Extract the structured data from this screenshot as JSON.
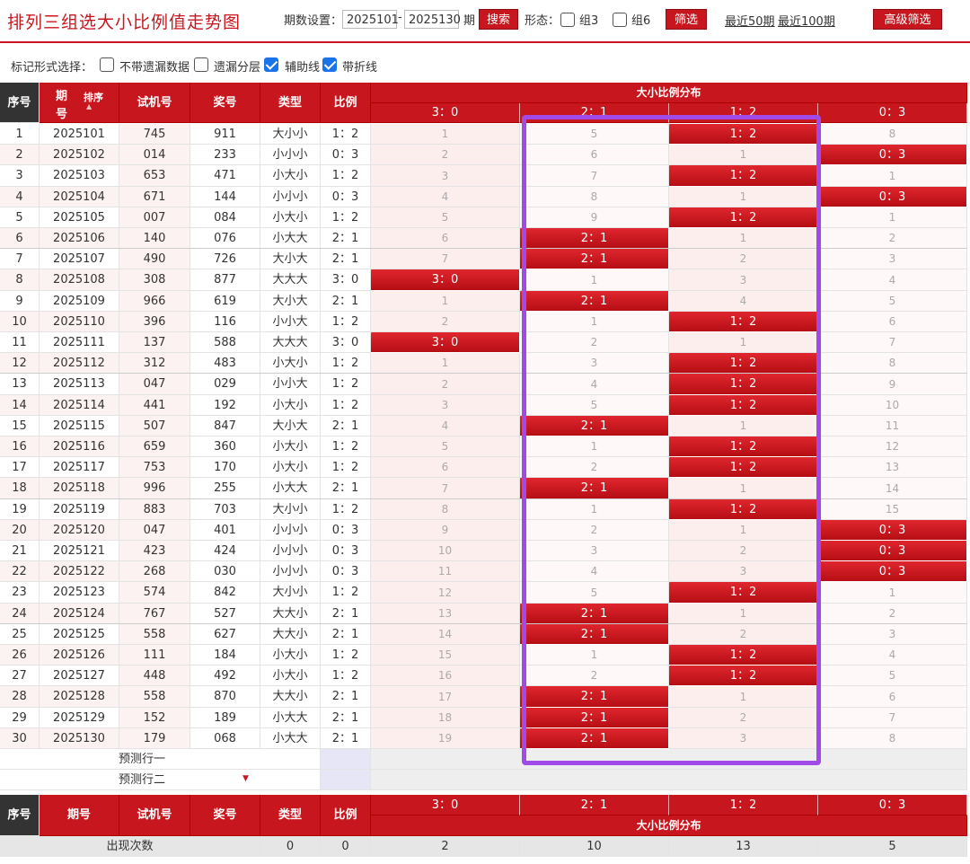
{
  "header": {
    "title": "排列三组选大小比例值走势图",
    "period_label": "期数设置：",
    "start_period": "2025101",
    "dash": "-",
    "end_period": "2025130",
    "period_unit": "期",
    "search_label": "搜索",
    "shape_label": "形态：",
    "group3_label": "组3",
    "group6_label": "组6",
    "filter_label": "筛选",
    "recent50_label": "最近50期",
    "recent100_label": "最近100期",
    "advanced_label": "高级筛选"
  },
  "options": {
    "label": "标记形式选择：",
    "items": [
      {
        "label": "不带遗漏数据",
        "checked": false
      },
      {
        "label": "遗漏分层",
        "checked": false
      },
      {
        "label": "辅助线",
        "checked": true
      },
      {
        "label": "带折线",
        "checked": true
      }
    ]
  },
  "table": {
    "headers": {
      "seq": "序号",
      "period_top": "期",
      "period_bottom": "号",
      "sort": "排序",
      "test_no": "试机号",
      "prize": "奖号",
      "type": "类型",
      "ratio": "比例",
      "dist": "大小比例分布",
      "bottom_period": "期号"
    },
    "ratio_cols": [
      "3：0",
      "2：1",
      "1：2",
      "0：3"
    ],
    "rows": [
      {
        "seq": "1",
        "period": "2025101",
        "test": "745",
        "prize": "911",
        "type": "大小小",
        "ratio": "1：2",
        "cols": [
          "1",
          "5",
          "1：2",
          "8"
        ]
      },
      {
        "seq": "2",
        "period": "2025102",
        "test": "014",
        "prize": "233",
        "type": "小小小",
        "ratio": "0：3",
        "cols": [
          "2",
          "6",
          "1",
          "0：3"
        ]
      },
      {
        "seq": "3",
        "period": "2025103",
        "test": "653",
        "prize": "471",
        "type": "小大小",
        "ratio": "1：2",
        "cols": [
          "3",
          "7",
          "1：2",
          "1"
        ]
      },
      {
        "seq": "4",
        "period": "2025104",
        "test": "671",
        "prize": "144",
        "type": "小小小",
        "ratio": "0：3",
        "cols": [
          "4",
          "8",
          "1",
          "0：3"
        ]
      },
      {
        "seq": "5",
        "period": "2025105",
        "test": "007",
        "prize": "084",
        "type": "小大小",
        "ratio": "1：2",
        "cols": [
          "5",
          "9",
          "1：2",
          "1"
        ]
      },
      {
        "seq": "6",
        "period": "2025106",
        "test": "140",
        "prize": "076",
        "type": "小大大",
        "ratio": "2：1",
        "cols": [
          "6",
          "2：1",
          "1",
          "2"
        ]
      },
      {
        "seq": "7",
        "period": "2025107",
        "test": "490",
        "prize": "726",
        "type": "大小大",
        "ratio": "2：1",
        "cols": [
          "7",
          "2：1",
          "2",
          "3"
        ]
      },
      {
        "seq": "8",
        "period": "2025108",
        "test": "308",
        "prize": "877",
        "type": "大大大",
        "ratio": "3：0",
        "cols": [
          "3：0",
          "1",
          "3",
          "4"
        ]
      },
      {
        "seq": "9",
        "period": "2025109",
        "test": "966",
        "prize": "619",
        "type": "大小大",
        "ratio": "2：1",
        "cols": [
          "1",
          "2：1",
          "4",
          "5"
        ]
      },
      {
        "seq": "10",
        "period": "2025110",
        "test": "396",
        "prize": "116",
        "type": "小小大",
        "ratio": "1：2",
        "cols": [
          "2",
          "1",
          "1：2",
          "6"
        ]
      },
      {
        "seq": "11",
        "period": "2025111",
        "test": "137",
        "prize": "588",
        "type": "大大大",
        "ratio": "3：0",
        "cols": [
          "3：0",
          "2",
          "1",
          "7"
        ]
      },
      {
        "seq": "12",
        "period": "2025112",
        "test": "312",
        "prize": "483",
        "type": "小大小",
        "ratio": "1：2",
        "cols": [
          "1",
          "3",
          "1：2",
          "8"
        ]
      },
      {
        "seq": "13",
        "period": "2025113",
        "test": "047",
        "prize": "029",
        "type": "小小大",
        "ratio": "1：2",
        "cols": [
          "2",
          "4",
          "1：2",
          "9"
        ]
      },
      {
        "seq": "14",
        "period": "2025114",
        "test": "441",
        "prize": "192",
        "type": "小大小",
        "ratio": "1：2",
        "cols": [
          "3",
          "5",
          "1：2",
          "10"
        ]
      },
      {
        "seq": "15",
        "period": "2025115",
        "test": "507",
        "prize": "847",
        "type": "大小大",
        "ratio": "2：1",
        "cols": [
          "4",
          "2：1",
          "1",
          "11"
        ]
      },
      {
        "seq": "16",
        "period": "2025116",
        "test": "659",
        "prize": "360",
        "type": "小大小",
        "ratio": "1：2",
        "cols": [
          "5",
          "1",
          "1：2",
          "12"
        ]
      },
      {
        "seq": "17",
        "period": "2025117",
        "test": "753",
        "prize": "170",
        "type": "小大小",
        "ratio": "1：2",
        "cols": [
          "6",
          "2",
          "1：2",
          "13"
        ]
      },
      {
        "seq": "18",
        "period": "2025118",
        "test": "996",
        "prize": "255",
        "type": "小大大",
        "ratio": "2：1",
        "cols": [
          "7",
          "2：1",
          "1",
          "14"
        ]
      },
      {
        "seq": "19",
        "period": "2025119",
        "test": "883",
        "prize": "703",
        "type": "大小小",
        "ratio": "1：2",
        "cols": [
          "8",
          "1",
          "1：2",
          "15"
        ]
      },
      {
        "seq": "20",
        "period": "2025120",
        "test": "047",
        "prize": "401",
        "type": "小小小",
        "ratio": "0：3",
        "cols": [
          "9",
          "2",
          "1",
          "0：3"
        ]
      },
      {
        "seq": "21",
        "period": "2025121",
        "test": "423",
        "prize": "424",
        "type": "小小小",
        "ratio": "0：3",
        "cols": [
          "10",
          "3",
          "2",
          "0：3"
        ]
      },
      {
        "seq": "22",
        "period": "2025122",
        "test": "268",
        "prize": "030",
        "type": "小小小",
        "ratio": "0：3",
        "cols": [
          "11",
          "4",
          "3",
          "0：3"
        ]
      },
      {
        "seq": "23",
        "period": "2025123",
        "test": "574",
        "prize": "842",
        "type": "大小小",
        "ratio": "1：2",
        "cols": [
          "12",
          "5",
          "1：2",
          "1"
        ]
      },
      {
        "seq": "24",
        "period": "2025124",
        "test": "767",
        "prize": "527",
        "type": "大大小",
        "ratio": "2：1",
        "cols": [
          "13",
          "2：1",
          "1",
          "2"
        ]
      },
      {
        "seq": "25",
        "period": "2025125",
        "test": "558",
        "prize": "627",
        "type": "大大小",
        "ratio": "2：1",
        "cols": [
          "14",
          "2：1",
          "2",
          "3"
        ]
      },
      {
        "seq": "26",
        "period": "2025126",
        "test": "111",
        "prize": "184",
        "type": "小大小",
        "ratio": "1：2",
        "cols": [
          "15",
          "1",
          "1：2",
          "4"
        ]
      },
      {
        "seq": "27",
        "period": "2025127",
        "test": "448",
        "prize": "492",
        "type": "小大小",
        "ratio": "1：2",
        "cols": [
          "16",
          "2",
          "1：2",
          "5"
        ]
      },
      {
        "seq": "28",
        "period": "2025128",
        "test": "558",
        "prize": "870",
        "type": "大大小",
        "ratio": "2：1",
        "cols": [
          "17",
          "2：1",
          "1",
          "6"
        ]
      },
      {
        "seq": "29",
        "period": "2025129",
        "test": "152",
        "prize": "189",
        "type": "小大大",
        "ratio": "2：1",
        "cols": [
          "18",
          "2：1",
          "2",
          "7"
        ]
      },
      {
        "seq": "30",
        "period": "2025130",
        "test": "179",
        "prize": "068",
        "type": "小大大",
        "ratio": "2：1",
        "cols": [
          "19",
          "2：1",
          "3",
          "8"
        ]
      }
    ],
    "predict": [
      "预测行一",
      "预测行二"
    ],
    "stats": {
      "label": "出现次数",
      "type": "0",
      "ratio": "0",
      "cols": [
        "2",
        "10",
        "13",
        "5"
      ]
    }
  },
  "colors": {
    "accent": "#c8161e",
    "highlight_box": "#a04be8"
  }
}
